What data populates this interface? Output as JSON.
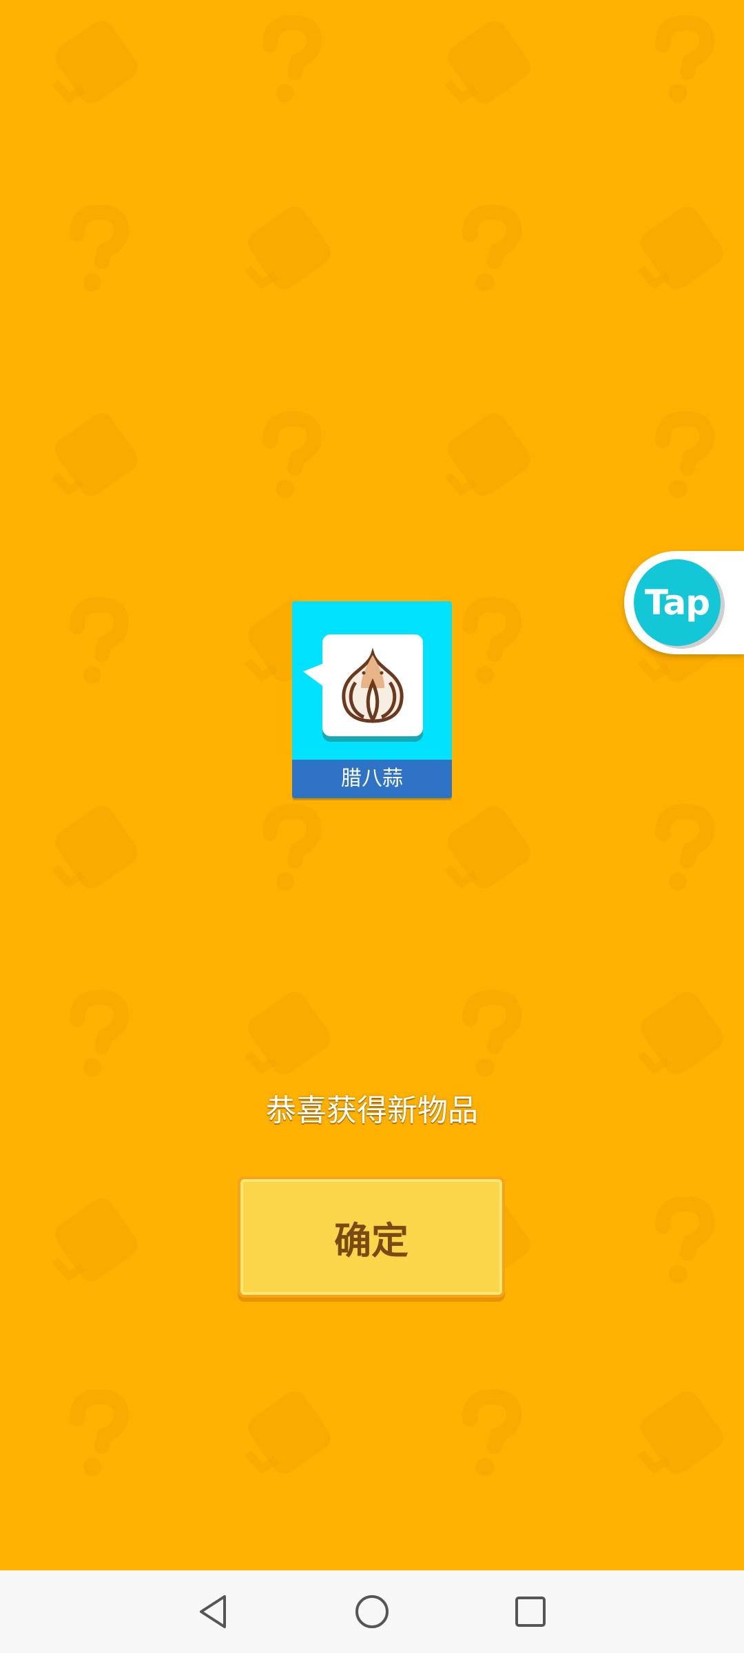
{
  "item_card": {
    "name": "腊八蒜",
    "icon": "garlic-icon"
  },
  "message": "恭喜获得新物品",
  "confirm_button": {
    "label": "确定"
  },
  "tap_widget": {
    "label": "Tap"
  },
  "nav_bar": {
    "back": "back-triangle-icon",
    "home": "home-circle-icon",
    "recents": "recents-square-icon"
  },
  "colors": {
    "background": "#FFB100",
    "card": "#00E2FF",
    "card_label_bg": "#2E73C6",
    "button": "#FBD54A",
    "tap": "#14C7D6"
  }
}
